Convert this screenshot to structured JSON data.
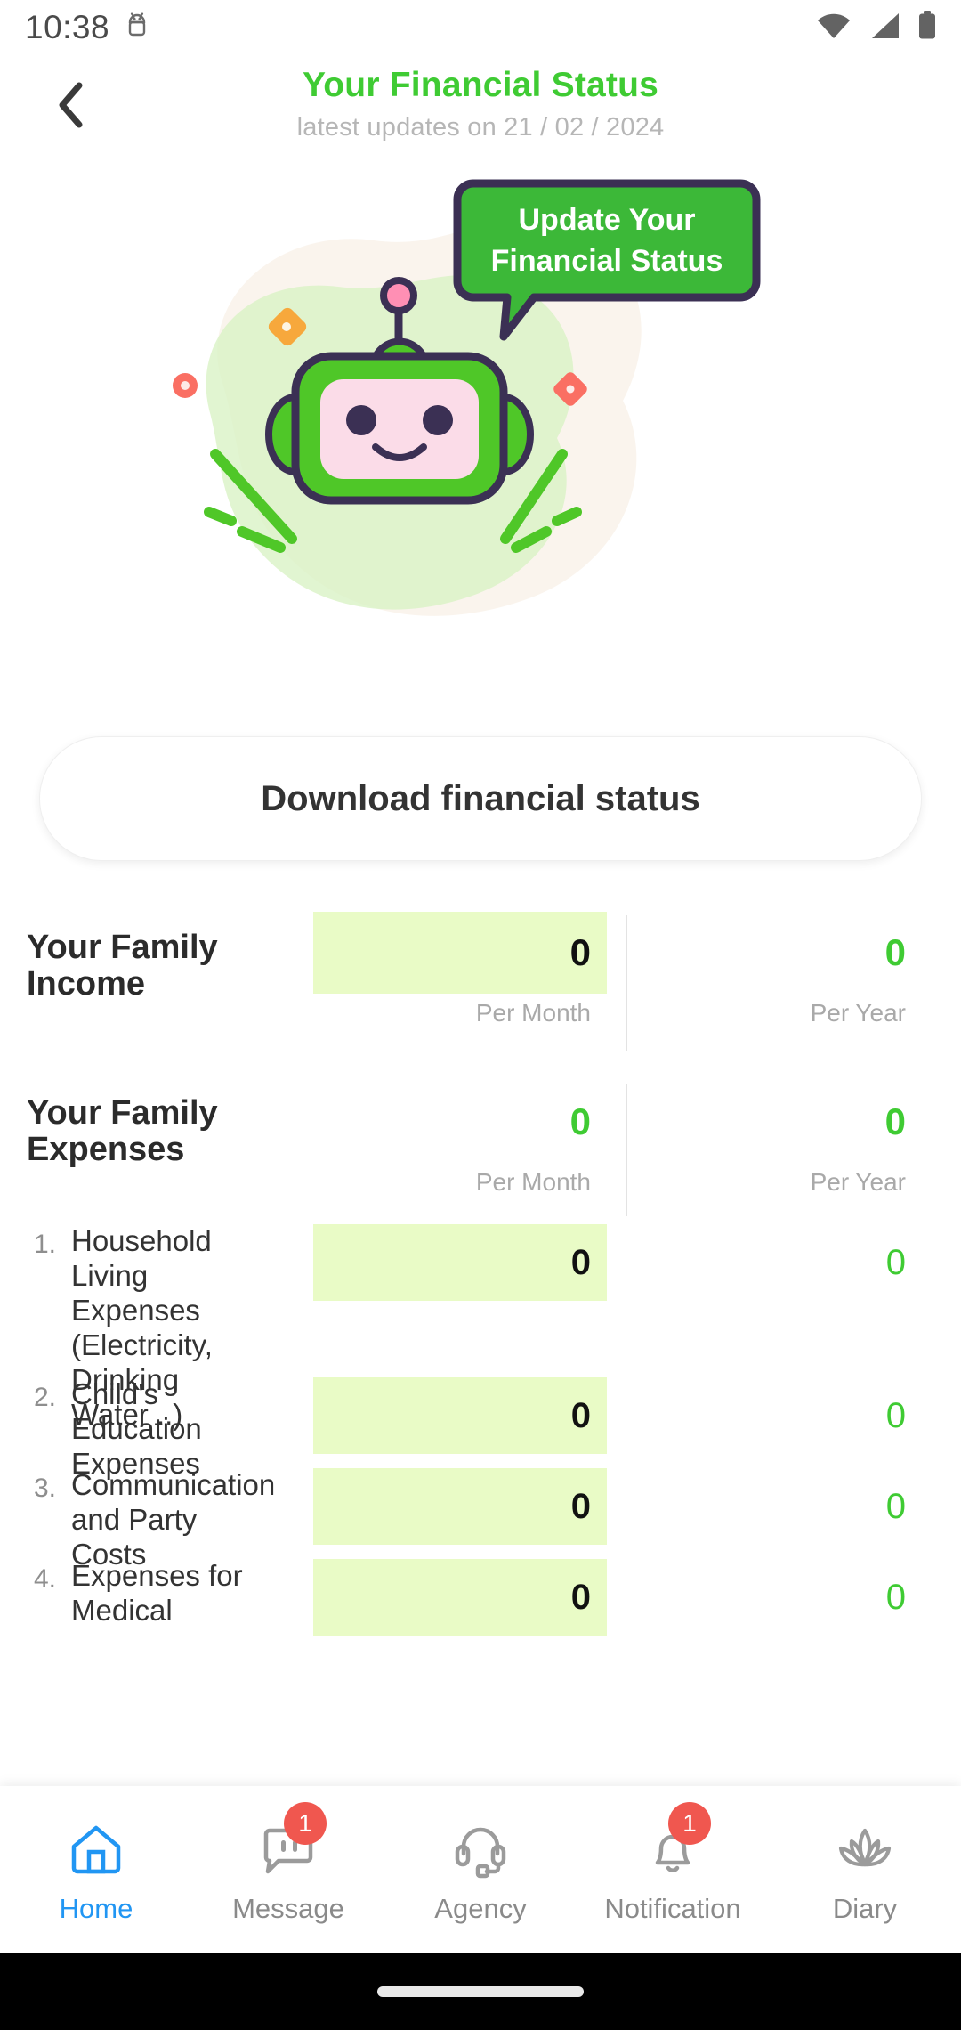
{
  "status_bar": {
    "time": "10:38",
    "icons": [
      "android-icon",
      "wifi-icon",
      "cellular-signal-icon",
      "battery-icon"
    ]
  },
  "header": {
    "back_icon": "chevron-left-icon",
    "title": "Your Financial Status",
    "subtitle": "latest updates on 21 / 02 / 2024",
    "title_color": "#3fcb33",
    "subtitle_color": "#b6b6b6"
  },
  "hero": {
    "illustration": "robot-mascot-illustration",
    "speech_bubble_line1": "Update Your",
    "speech_bubble_line2": "Financial Status",
    "bubble_fill": "#3cb838",
    "bubble_border": "#3b3054"
  },
  "download_button": {
    "label": "Download financial status"
  },
  "summary": {
    "income": {
      "label_line1": "Your Family",
      "label_line2": "Income",
      "per_month_value": "0",
      "per_month_label": "Per Month",
      "per_year_value": "0",
      "per_year_label": "Per Year"
    },
    "expenses": {
      "label_line1": "Your Family",
      "label_line2": "Expenses",
      "per_month_value": "0",
      "per_month_label": "Per Month",
      "per_year_value": "0",
      "per_year_label": "Per Year"
    }
  },
  "expense_items": [
    {
      "index": "1.",
      "name": "Household Living Expenses (Electricity, Drinking Water ..)",
      "per_month": "0",
      "per_year": "0"
    },
    {
      "index": "2.",
      "name": "Child's Education Expenses",
      "per_month": "0",
      "per_year": "0"
    },
    {
      "index": "3.",
      "name": "Communication and Party Costs",
      "per_month": "0",
      "per_year": "0"
    },
    {
      "index": "4.",
      "name": "Expenses for Medical",
      "per_month": "0",
      "per_year": "0"
    }
  ],
  "bottom_nav": {
    "items": [
      {
        "label": "Home",
        "icon": "home-icon",
        "active": true,
        "badge": ""
      },
      {
        "label": "Message",
        "icon": "message-icon",
        "active": false,
        "badge": "1"
      },
      {
        "label": "Agency",
        "icon": "headset-icon",
        "active": false,
        "badge": ""
      },
      {
        "label": "Notification",
        "icon": "bell-icon",
        "active": false,
        "badge": "1"
      },
      {
        "label": "Diary",
        "icon": "lotus-icon",
        "active": false,
        "badge": ""
      }
    ],
    "active_color": "#2196f3",
    "inactive_color": "#8a8a8a",
    "badge_color": "#f0574f"
  },
  "gesture_bar": {
    "indicator": "home-indicator"
  }
}
